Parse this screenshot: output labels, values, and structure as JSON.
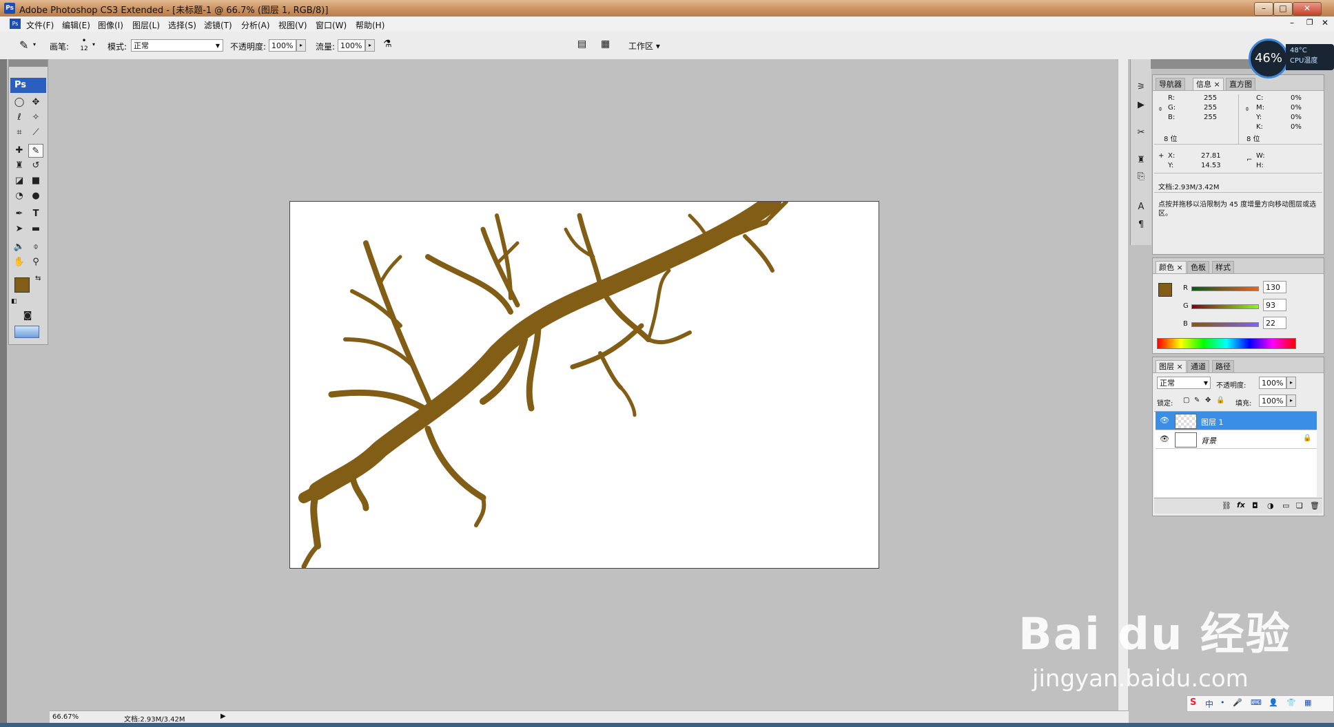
{
  "window": {
    "title": "Adobe Photoshop CS3 Extended - [未标题-1 @ 66.7% (图层 1, RGB/8)]",
    "app_icon": "Ps"
  },
  "menu": [
    "文件(F)",
    "编辑(E)",
    "图像(I)",
    "图层(L)",
    "选择(S)",
    "滤镜(T)",
    "分析(A)",
    "视图(V)",
    "窗口(W)",
    "帮助(H)"
  ],
  "options": {
    "brush_label": "画笔:",
    "brush_size": "12",
    "mode_label": "模式:",
    "mode_value": "正常",
    "opacity_label": "不透明度:",
    "opacity_value": "100%",
    "flow_label": "流量:",
    "flow_value": "100%",
    "workspace_label": "工作区 ▾"
  },
  "toolbox": {
    "logo": "Ps",
    "foreground_color": "#825d16",
    "background_color": "#ffffff"
  },
  "canvas": {
    "background": "#ffffff",
    "stroke_color": "#825d16"
  },
  "cpu": {
    "percent": "46%",
    "temp": "48°C",
    "label": "CPU温度"
  },
  "panels": {
    "info": {
      "tabs": [
        "导航器",
        "信息 ×",
        "直方图"
      ],
      "rgb": {
        "r_label": "R:",
        "g_label": "G:",
        "b_label": "B:",
        "r": "255",
        "g": "255",
        "b": "255"
      },
      "cmyk": {
        "c_label": "C:",
        "m_label": "M:",
        "y_label": "Y:",
        "k_label": "K:",
        "c": "0%",
        "m": "0%",
        "y": "0%",
        "k": "0%"
      },
      "bits_left": "8 位",
      "bits_right": "8 位",
      "x_label": "X:",
      "y_label": "Y:",
      "x": "27.81",
      "y": "14.53",
      "w_label": "W:",
      "h_label": "H:",
      "doc": "文档:2.93M/3.42M",
      "hint": "点按并拖移以沿限制为 45 度增量方向移动图层或选区。"
    },
    "color": {
      "tabs": [
        "颜色 ×",
        "色板",
        "样式"
      ],
      "r_label": "R",
      "g_label": "G",
      "b_label": "B",
      "r": "130",
      "g": "93",
      "b": "22"
    },
    "layers": {
      "tabs": [
        "图层 ×",
        "通道",
        "路径"
      ],
      "blend": "正常",
      "opacity_label": "不透明度:",
      "opacity": "100%",
      "lock_label": "锁定:",
      "fill_label": "填充:",
      "fill": "100%",
      "items": [
        {
          "name": "图层 1",
          "selected": true
        },
        {
          "name": "背景",
          "selected": false
        }
      ],
      "footer_icons": [
        "link-icon",
        "fx-icon",
        "mask-icon",
        "adjustment-icon",
        "group-icon",
        "new-layer-icon",
        "trash-icon"
      ]
    }
  },
  "status": {
    "zoom": "66.67%",
    "doc": "文档:2.93M/3.42M"
  },
  "watermark": {
    "brand": "Bai du 经验",
    "url": "jingyan.baidu.com"
  }
}
